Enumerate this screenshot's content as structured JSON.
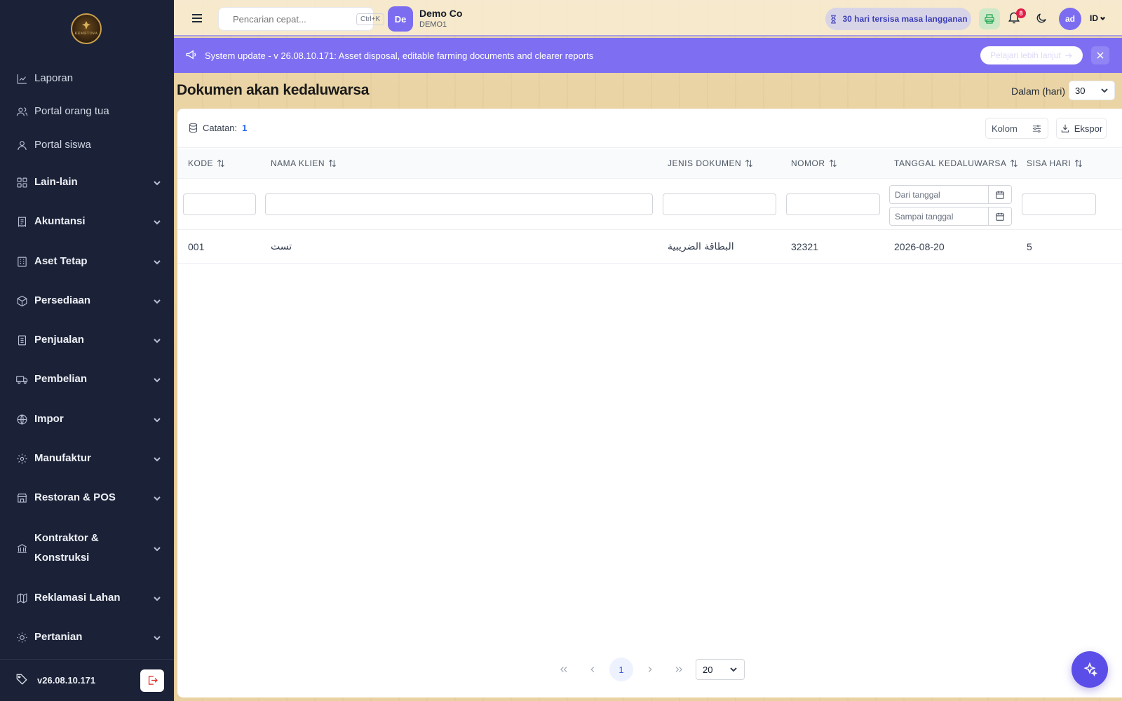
{
  "sidebar": {
    "logo_text": "KEMETOVA",
    "items": [
      {
        "label": "Laporan",
        "icon": "chart-line-icon",
        "group": false
      },
      {
        "label": "Portal orang tua",
        "icon": "users-icon",
        "group": false
      },
      {
        "label": "Portal siswa",
        "icon": "user-icon",
        "group": false
      },
      {
        "label": "Lain-lain",
        "icon": "grid-icon",
        "group": true
      },
      {
        "label": "Akuntansi",
        "icon": "receipt-icon",
        "group": true
      },
      {
        "label": "Aset Tetap",
        "icon": "building-icon",
        "group": true
      },
      {
        "label": "Persediaan",
        "icon": "box-icon",
        "group": true
      },
      {
        "label": "Penjualan",
        "icon": "invoice-icon",
        "group": true
      },
      {
        "label": "Pembelian",
        "icon": "truck-icon",
        "group": true
      },
      {
        "label": "Impor",
        "icon": "globe-icon",
        "group": true
      },
      {
        "label": "Manufaktur",
        "icon": "cog-icon",
        "group": true
      },
      {
        "label": "Restoran & POS",
        "icon": "store-icon",
        "group": true
      },
      {
        "label": "Kontraktor & Konstruksi",
        "icon": "bank-icon",
        "group": true
      },
      {
        "label": "Reklamasi Lahan",
        "icon": "map-icon",
        "group": true
      },
      {
        "label": "Pertanian",
        "icon": "sun-icon",
        "group": true
      }
    ],
    "version": "v26.08.10.171"
  },
  "header": {
    "search_placeholder": "Pencarian cepat...",
    "search_shortcut": "Ctrl+K",
    "company_initials": "De",
    "company_name": "Demo Co",
    "company_code": "DEMO1",
    "subscription_text": "30 hari tersisa masa langganan",
    "notification_count": "8",
    "user_initials": "ad",
    "language": "ID"
  },
  "banner": {
    "text": "System update - v 26.08.10.171: Asset disposal, editable farming documents and clearer reports",
    "button_label": "Pelajari lebih lanjut"
  },
  "page": {
    "title": "Dokumen akan kedaluwarsa",
    "days_label": "Dalam (hari)",
    "days_value": "30"
  },
  "toolbar": {
    "records_label": "Catatan:",
    "records_count": "1",
    "columns_label": "Kolom",
    "export_label": "Ekspor"
  },
  "table": {
    "columns": [
      "KODE",
      "NAMA KLIEN",
      "JENIS DOKUMEN",
      "NOMOR",
      "TANGGAL KEDALUWARSA",
      "SISA HARI"
    ],
    "date_from_placeholder": "Dari tanggal",
    "date_to_placeholder": "Sampai tanggal",
    "rows": [
      {
        "kode": "001",
        "nama_klien": "تست",
        "jenis_dokumen": "البطاقة الضريبية",
        "nomor": "32321",
        "tanggal": "2026-08-20",
        "sisa_hari": "5"
      }
    ]
  },
  "pagination": {
    "current_page": "1",
    "page_size": "20"
  },
  "colors": {
    "sidebar_bg": "#1b2136",
    "accent": "#7e6ff2",
    "fab": "#5b4ee8"
  }
}
